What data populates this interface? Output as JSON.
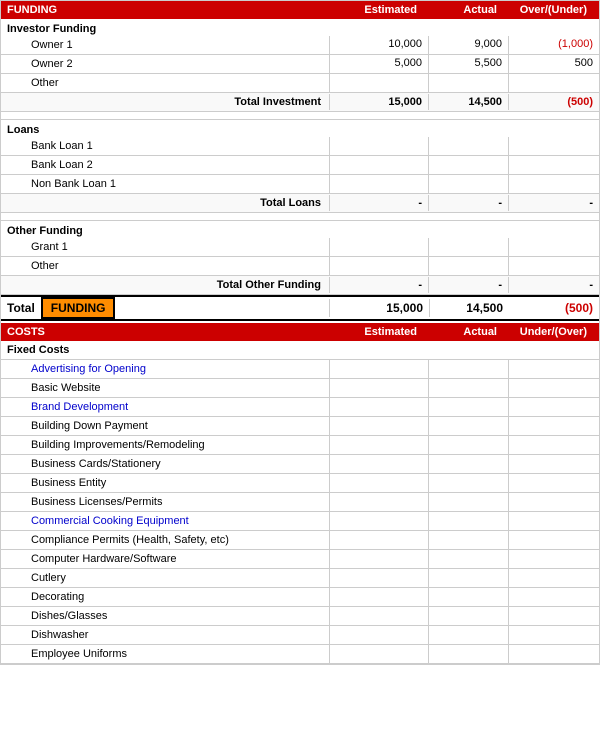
{
  "header": {
    "funding_label": "FUNDING",
    "estimated_label": "Estimated",
    "actual_label": "Actual",
    "over_under_label": "Over/(Under)"
  },
  "investor_funding": {
    "section_label": "Investor Funding",
    "rows": [
      {
        "label": "Owner 1",
        "estimated": "10,000",
        "actual": "9,000",
        "over": "(1,000)",
        "over_class": "red"
      },
      {
        "label": "Owner 2",
        "estimated": "5,000",
        "actual": "5,500",
        "over": "500",
        "over_class": ""
      },
      {
        "label": "Other",
        "estimated": "",
        "actual": "",
        "over": "",
        "over_class": ""
      }
    ],
    "total_label": "Total Investment",
    "total_est": "15,000",
    "total_act": "14,500",
    "total_over": "(500)",
    "total_over_class": "red"
  },
  "loans": {
    "section_label": "Loans",
    "rows": [
      {
        "label": "Bank Loan 1",
        "estimated": "",
        "actual": "",
        "over": ""
      },
      {
        "label": "Bank Loan 2",
        "estimated": "",
        "actual": "",
        "over": ""
      },
      {
        "label": "Non Bank Loan 1",
        "estimated": "",
        "actual": "",
        "over": ""
      }
    ],
    "total_label": "Total Loans",
    "total_est": "-",
    "total_act": "-",
    "total_over": "-"
  },
  "other_funding": {
    "section_label": "Other Funding",
    "rows": [
      {
        "label": "Grant 1",
        "estimated": "",
        "actual": "",
        "over": ""
      },
      {
        "label": "Other",
        "estimated": "",
        "actual": "",
        "over": ""
      }
    ],
    "total_label": "Total Other Funding",
    "total_est": "-",
    "total_act": "-",
    "total_over": "-"
  },
  "grand_total": {
    "word": "Total",
    "box_label": "FUNDING",
    "est": "15,000",
    "act": "14,500",
    "over": "(500)",
    "over_class": "red"
  },
  "costs_header": {
    "label": "COSTS",
    "estimated_label": "Estimated",
    "actual_label": "Actual",
    "over_under_label": "Under/(Over)"
  },
  "fixed_costs": {
    "section_label": "Fixed Costs",
    "rows": [
      {
        "label": "Advertising for Opening",
        "blue": true
      },
      {
        "label": "Basic Website",
        "blue": false
      },
      {
        "label": "Brand Development",
        "blue": true
      },
      {
        "label": "Building Down Payment",
        "blue": false
      },
      {
        "label": "Building Improvements/Remodeling",
        "blue": false
      },
      {
        "label": "Business Cards/Stationery",
        "blue": false
      },
      {
        "label": "Business Entity",
        "blue": false
      },
      {
        "label": "Business Licenses/Permits",
        "blue": false
      },
      {
        "label": "Commercial Cooking Equipment",
        "blue": true
      },
      {
        "label": "Compliance Permits (Health, Safety, etc)",
        "blue": false
      },
      {
        "label": "Computer Hardware/Software",
        "blue": false
      },
      {
        "label": "Cutlery",
        "blue": false
      },
      {
        "label": "Decorating",
        "blue": false
      },
      {
        "label": "Dishes/Glasses",
        "blue": false
      },
      {
        "label": "Dishwasher",
        "blue": false
      },
      {
        "label": "Employee Uniforms",
        "blue": false
      }
    ]
  }
}
